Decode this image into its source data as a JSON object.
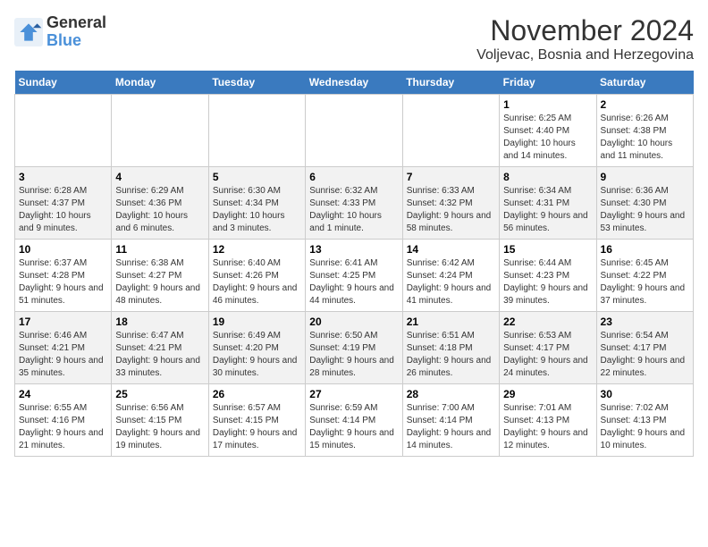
{
  "header": {
    "logo_line1": "General",
    "logo_line2": "Blue",
    "month_year": "November 2024",
    "location": "Voljevac, Bosnia and Herzegovina"
  },
  "weekdays": [
    "Sunday",
    "Monday",
    "Tuesday",
    "Wednesday",
    "Thursday",
    "Friday",
    "Saturday"
  ],
  "weeks": [
    [
      {
        "day": "",
        "info": ""
      },
      {
        "day": "",
        "info": ""
      },
      {
        "day": "",
        "info": ""
      },
      {
        "day": "",
        "info": ""
      },
      {
        "day": "",
        "info": ""
      },
      {
        "day": "1",
        "info": "Sunrise: 6:25 AM\nSunset: 4:40 PM\nDaylight: 10 hours and 14 minutes."
      },
      {
        "day": "2",
        "info": "Sunrise: 6:26 AM\nSunset: 4:38 PM\nDaylight: 10 hours and 11 minutes."
      }
    ],
    [
      {
        "day": "3",
        "info": "Sunrise: 6:28 AM\nSunset: 4:37 PM\nDaylight: 10 hours and 9 minutes."
      },
      {
        "day": "4",
        "info": "Sunrise: 6:29 AM\nSunset: 4:36 PM\nDaylight: 10 hours and 6 minutes."
      },
      {
        "day": "5",
        "info": "Sunrise: 6:30 AM\nSunset: 4:34 PM\nDaylight: 10 hours and 3 minutes."
      },
      {
        "day": "6",
        "info": "Sunrise: 6:32 AM\nSunset: 4:33 PM\nDaylight: 10 hours and 1 minute."
      },
      {
        "day": "7",
        "info": "Sunrise: 6:33 AM\nSunset: 4:32 PM\nDaylight: 9 hours and 58 minutes."
      },
      {
        "day": "8",
        "info": "Sunrise: 6:34 AM\nSunset: 4:31 PM\nDaylight: 9 hours and 56 minutes."
      },
      {
        "day": "9",
        "info": "Sunrise: 6:36 AM\nSunset: 4:30 PM\nDaylight: 9 hours and 53 minutes."
      }
    ],
    [
      {
        "day": "10",
        "info": "Sunrise: 6:37 AM\nSunset: 4:28 PM\nDaylight: 9 hours and 51 minutes."
      },
      {
        "day": "11",
        "info": "Sunrise: 6:38 AM\nSunset: 4:27 PM\nDaylight: 9 hours and 48 minutes."
      },
      {
        "day": "12",
        "info": "Sunrise: 6:40 AM\nSunset: 4:26 PM\nDaylight: 9 hours and 46 minutes."
      },
      {
        "day": "13",
        "info": "Sunrise: 6:41 AM\nSunset: 4:25 PM\nDaylight: 9 hours and 44 minutes."
      },
      {
        "day": "14",
        "info": "Sunrise: 6:42 AM\nSunset: 4:24 PM\nDaylight: 9 hours and 41 minutes."
      },
      {
        "day": "15",
        "info": "Sunrise: 6:44 AM\nSunset: 4:23 PM\nDaylight: 9 hours and 39 minutes."
      },
      {
        "day": "16",
        "info": "Sunrise: 6:45 AM\nSunset: 4:22 PM\nDaylight: 9 hours and 37 minutes."
      }
    ],
    [
      {
        "day": "17",
        "info": "Sunrise: 6:46 AM\nSunset: 4:21 PM\nDaylight: 9 hours and 35 minutes."
      },
      {
        "day": "18",
        "info": "Sunrise: 6:47 AM\nSunset: 4:21 PM\nDaylight: 9 hours and 33 minutes."
      },
      {
        "day": "19",
        "info": "Sunrise: 6:49 AM\nSunset: 4:20 PM\nDaylight: 9 hours and 30 minutes."
      },
      {
        "day": "20",
        "info": "Sunrise: 6:50 AM\nSunset: 4:19 PM\nDaylight: 9 hours and 28 minutes."
      },
      {
        "day": "21",
        "info": "Sunrise: 6:51 AM\nSunset: 4:18 PM\nDaylight: 9 hours and 26 minutes."
      },
      {
        "day": "22",
        "info": "Sunrise: 6:53 AM\nSunset: 4:17 PM\nDaylight: 9 hours and 24 minutes."
      },
      {
        "day": "23",
        "info": "Sunrise: 6:54 AM\nSunset: 4:17 PM\nDaylight: 9 hours and 22 minutes."
      }
    ],
    [
      {
        "day": "24",
        "info": "Sunrise: 6:55 AM\nSunset: 4:16 PM\nDaylight: 9 hours and 21 minutes."
      },
      {
        "day": "25",
        "info": "Sunrise: 6:56 AM\nSunset: 4:15 PM\nDaylight: 9 hours and 19 minutes."
      },
      {
        "day": "26",
        "info": "Sunrise: 6:57 AM\nSunset: 4:15 PM\nDaylight: 9 hours and 17 minutes."
      },
      {
        "day": "27",
        "info": "Sunrise: 6:59 AM\nSunset: 4:14 PM\nDaylight: 9 hours and 15 minutes."
      },
      {
        "day": "28",
        "info": "Sunrise: 7:00 AM\nSunset: 4:14 PM\nDaylight: 9 hours and 14 minutes."
      },
      {
        "day": "29",
        "info": "Sunrise: 7:01 AM\nSunset: 4:13 PM\nDaylight: 9 hours and 12 minutes."
      },
      {
        "day": "30",
        "info": "Sunrise: 7:02 AM\nSunset: 4:13 PM\nDaylight: 9 hours and 10 minutes."
      }
    ]
  ]
}
